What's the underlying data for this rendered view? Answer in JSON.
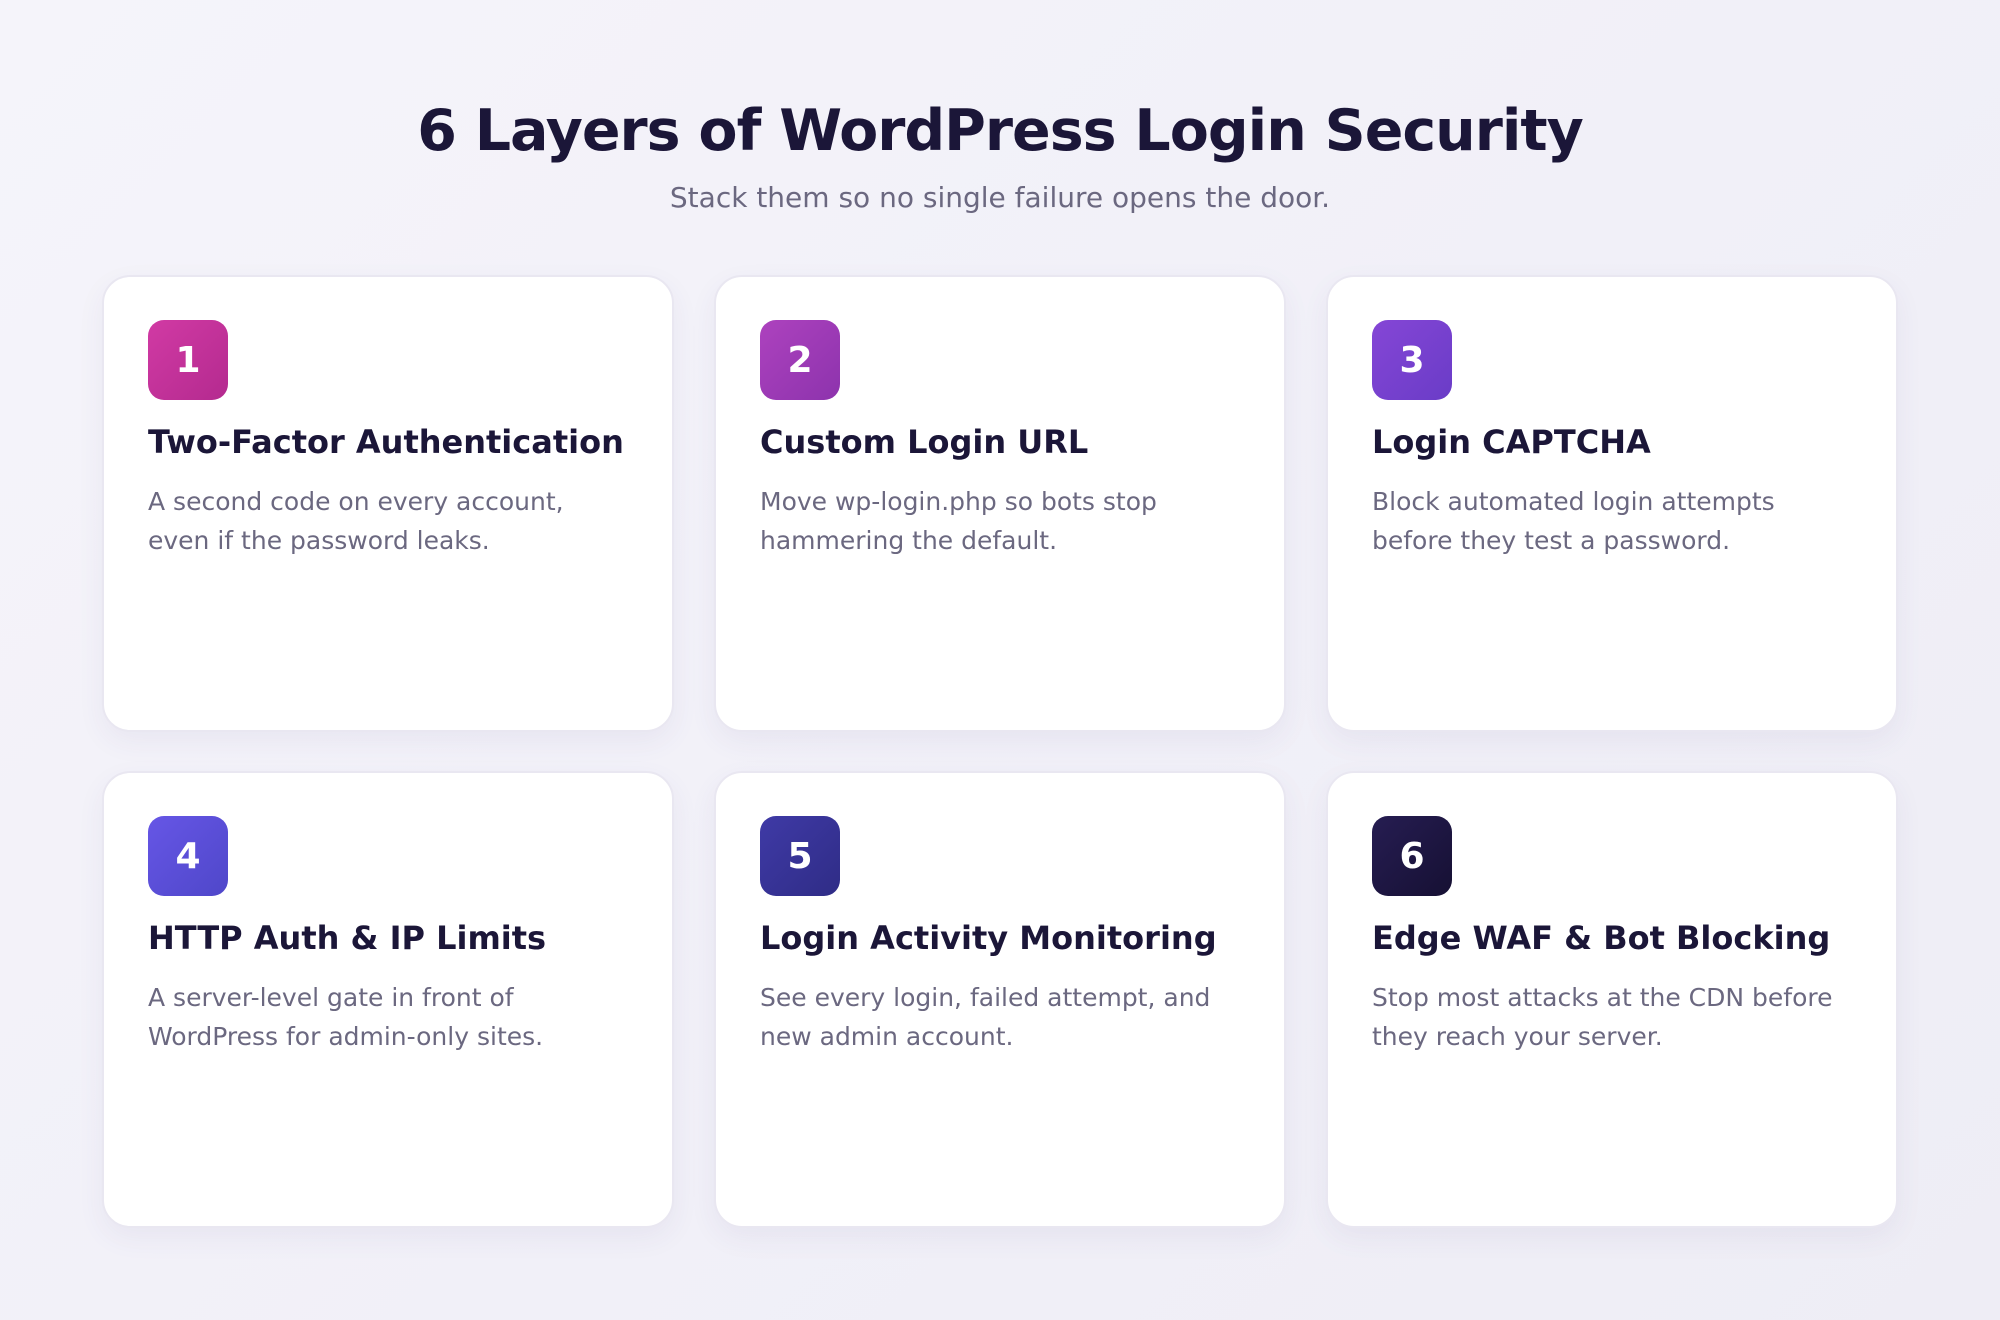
{
  "header": {
    "title": "6 Layers of WordPress Login Security",
    "subtitle": "Stack them so no single failure opens the door."
  },
  "colors": {
    "background": "#f3f2f9",
    "card": "#ffffff",
    "heading": "#1b1638",
    "body_text": "#6b6880",
    "badges": [
      "#c2329a",
      "#9d3bb6",
      "#773fcf",
      "#5a4fd8",
      "#373396",
      "#1e1742"
    ]
  },
  "cards": [
    {
      "number": "1",
      "title": "Two-Factor Authentication",
      "description": "A second code on every account, even if the password leaks."
    },
    {
      "number": "2",
      "title": "Custom Login URL",
      "description": "Move wp-login.php so bots stop hammering the default."
    },
    {
      "number": "3",
      "title": "Login CAPTCHA",
      "description": "Block automated login attempts before they test a password."
    },
    {
      "number": "4",
      "title": "HTTP Auth & IP Limits",
      "description": "A server-level gate in front of WordPress for admin-only sites."
    },
    {
      "number": "5",
      "title": "Login Activity Monitoring",
      "description": "See every login, failed attempt, and new admin account."
    },
    {
      "number": "6",
      "title": "Edge WAF & Bot Blocking",
      "description": "Stop most attacks at the CDN before they reach your server."
    }
  ]
}
